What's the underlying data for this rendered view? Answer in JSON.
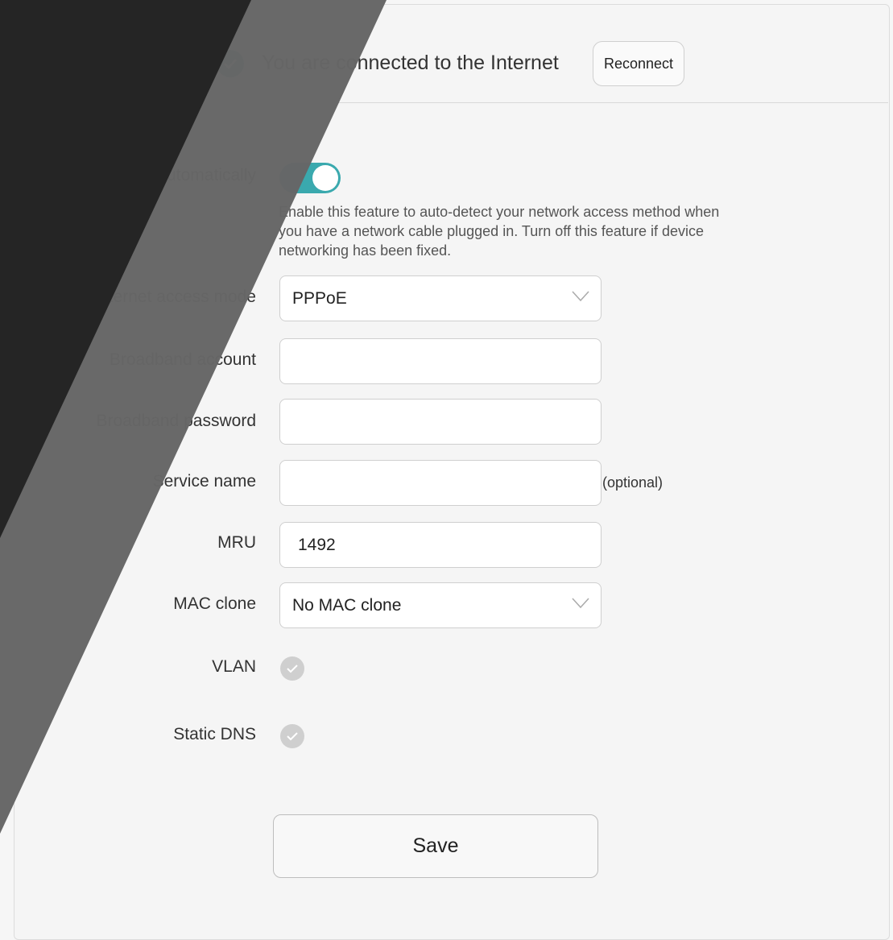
{
  "status": {
    "message": "You are connected to the Internet",
    "reconnect_label": "Reconnect",
    "icon": "check-circle-icon",
    "icon_color": "#2e8f94"
  },
  "form": {
    "auto_detect": {
      "label": "Automatically",
      "enabled": true,
      "help_text": "Enable this feature to auto-detect your network access method when you have a network cable plugged in. Turn off this feature if device networking has been fixed."
    },
    "access_mode": {
      "label": "Internet access mode",
      "value": "PPPoE"
    },
    "broadband_account": {
      "label": "Broadband account",
      "value": ""
    },
    "broadband_password": {
      "label": "Broadband password",
      "value": ""
    },
    "service_name": {
      "label": "Service name",
      "value": "",
      "hint": "(optional)"
    },
    "mru": {
      "label": "MRU",
      "value": "1492"
    },
    "mac_clone": {
      "label": "MAC clone",
      "value": "No MAC clone"
    },
    "vlan": {
      "label": "VLAN",
      "checked": false
    },
    "static_dns": {
      "label": "Static DNS",
      "checked": false
    },
    "save_label": "Save"
  },
  "colors": {
    "accent": "#3aa9ae",
    "overlay_dark": "#252525",
    "overlay_mid": "#666666"
  }
}
